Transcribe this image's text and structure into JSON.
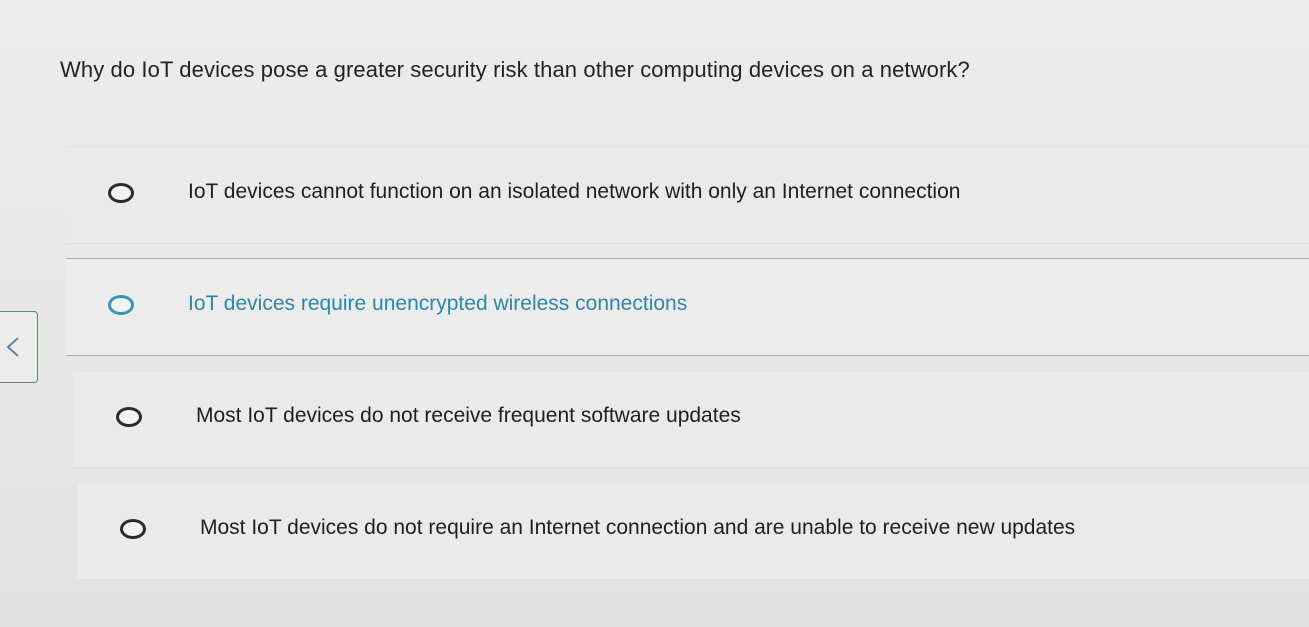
{
  "question": {
    "text": "Why do IoT devices pose a greater security risk than other computing devices on a network?"
  },
  "options": [
    {
      "label": "IoT devices cannot function on an isolated network with only an Internet connection",
      "selected": false
    },
    {
      "label": "IoT devices require unencrypted wireless connections",
      "selected": true
    },
    {
      "label": "Most IoT devices do not receive frequent software updates",
      "selected": false
    },
    {
      "label": "Most IoT devices do not require an Internet connection and are unable to receive new updates",
      "selected": false
    }
  ],
  "navigation": {
    "back_icon": "chevron-left-icon"
  },
  "colors": {
    "highlight": "#2f86a6",
    "text": "#1f1f1f",
    "back_tab_border": "#5b8a5b"
  }
}
